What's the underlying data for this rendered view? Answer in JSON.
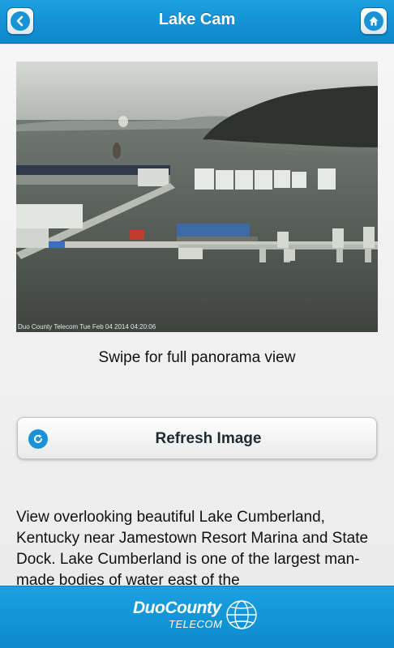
{
  "header": {
    "title": "Lake Cam",
    "back_icon": "chevron-left-icon",
    "home_icon": "home-icon"
  },
  "camera": {
    "timestamp": "Duo County Telecom Tue Feb 04 2014 04:20:06"
  },
  "main": {
    "caption": "Swipe for full panorama view",
    "refresh_label": "Refresh Image",
    "refresh_icon": "refresh-icon",
    "description": "View overlooking beautiful Lake Cumberland, Kentucky near Jamestown Resort Marina and State Dock. Lake Cumberland is one of the largest man-made bodies of water east of the"
  },
  "footer": {
    "logo_line1": "DuoCounty",
    "logo_line2": "TELECOM"
  },
  "colors": {
    "header_blue": "#0b88cb",
    "accent": "#1a93d6"
  }
}
